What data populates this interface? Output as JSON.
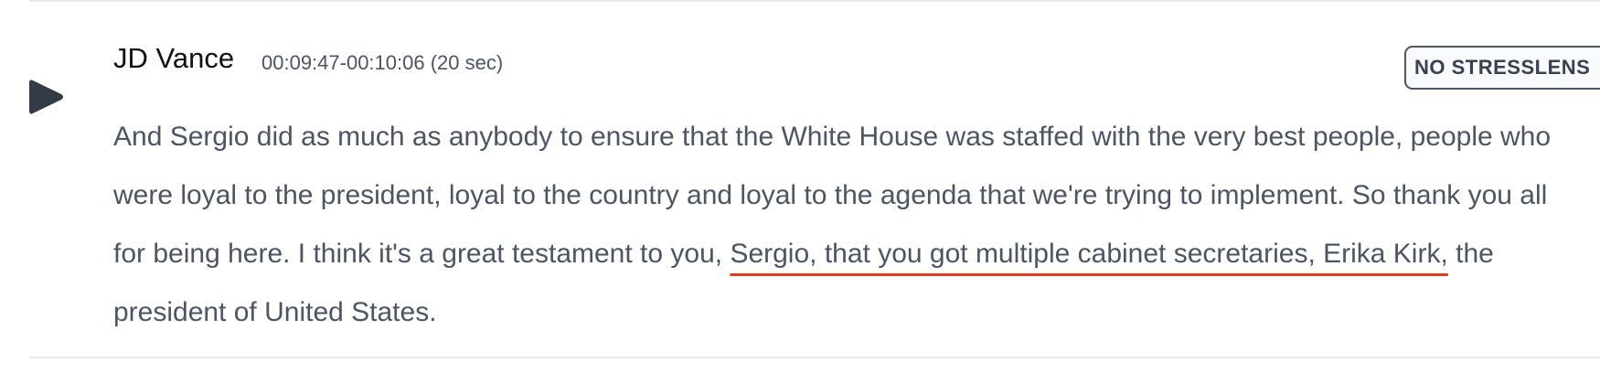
{
  "segment": {
    "speaker": "JD Vance",
    "timestamp": "00:09:47-00:10:06 (20 sec)",
    "badge_label": "NO STRESSLENS",
    "text_before": "And Sergio did as much as anybody to ensure that the White House was staffed with the very best people, people who were loyal to the president, loyal to the country and loyal to the agenda that we're trying to implement. So thank you all for being here. I think it's a great testament to you, ",
    "text_highlight": "Sergio, that you got multiple cabinet secretaries, Erika Kirk,",
    "text_after": " the president of United States.",
    "play_icon": "play-icon"
  },
  "colors": {
    "highlight_underline": "#e63b19",
    "play_icon": "#333b46",
    "text": "#4b5563",
    "speaker": "#111111"
  }
}
